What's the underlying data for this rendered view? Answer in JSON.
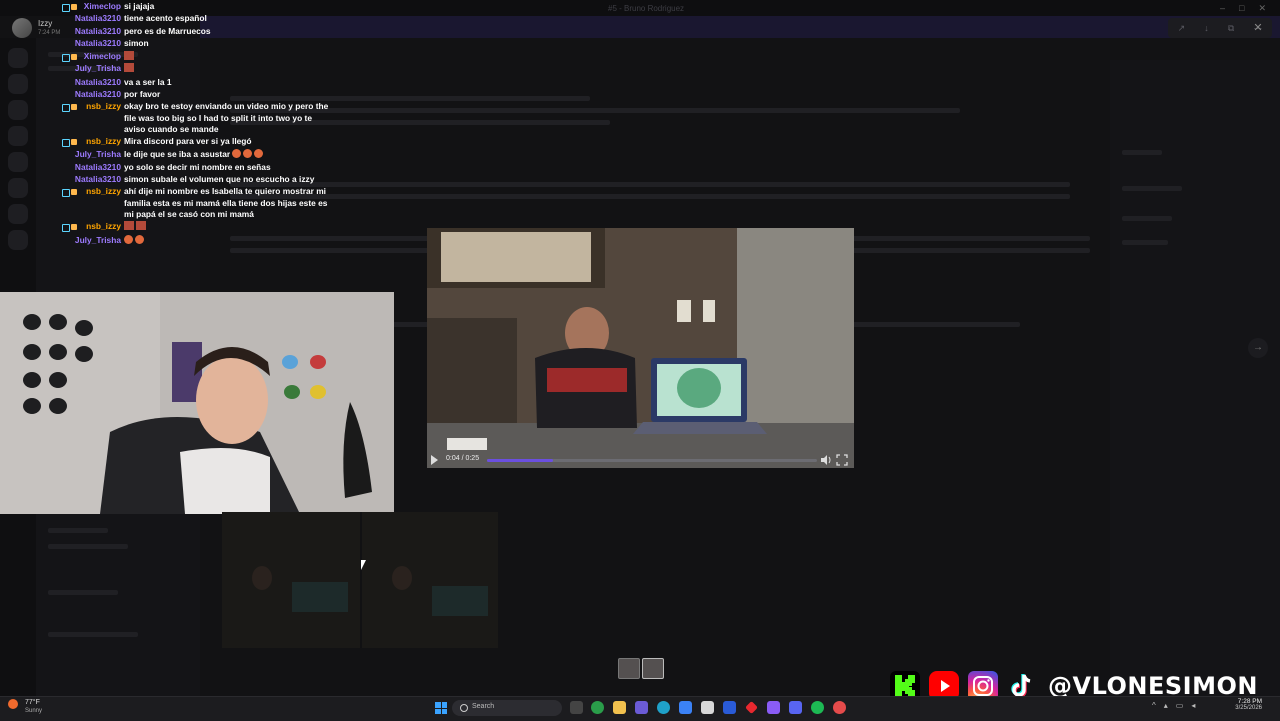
{
  "window": {
    "title": "#5 - Bruno Rodriguez"
  },
  "streamer": {
    "name": "Izzy",
    "time": "7:24 PM"
  },
  "chat": [
    {
      "user": "Ximeclop",
      "color": "#9d7bff",
      "badges": true,
      "text": "si jajaja"
    },
    {
      "user": "Natalia3210",
      "color": "#9d7bff",
      "badges": false,
      "text": "tiene acento español"
    },
    {
      "user": "Natalia3210",
      "color": "#9d7bff",
      "badges": false,
      "text": "pero es de Marruecos"
    },
    {
      "user": "Natalia3210",
      "color": "#9d7bff",
      "badges": false,
      "text": "simon"
    },
    {
      "user": "Ximeclop",
      "color": "#9d7bff",
      "badges": true,
      "text": ""
    },
    {
      "user": "July_Trisha",
      "color": "#9d7bff",
      "badges": false,
      "text": ""
    },
    {
      "user": "Natalia3210",
      "color": "#9d7bff",
      "badges": false,
      "text": "va a ser la 1"
    },
    {
      "user": "Natalia3210",
      "color": "#9d7bff",
      "badges": false,
      "text": "por favor"
    },
    {
      "user": "nsb_izzy",
      "color": "#ffa500",
      "badges": true,
      "text": "okay bro te estoy enviando un video mio y pero the file was too big so I had to split it into two yo te aviso cuando se mande"
    },
    {
      "user": "nsb_izzy",
      "color": "#ffa500",
      "badges": true,
      "text": "Mira discord para ver si ya llegó"
    },
    {
      "user": "July_Trisha",
      "color": "#9d7bff",
      "badges": false,
      "text": "le dije que se iba a asustar"
    },
    {
      "user": "Natalia3210",
      "color": "#9d7bff",
      "badges": false,
      "text": "yo solo se decir mi nombre en señas"
    },
    {
      "user": "Natalia3210",
      "color": "#9d7bff",
      "badges": false,
      "text": "simon subale el volumen que no escucho a izzy"
    },
    {
      "user": "nsb_izzy",
      "color": "#ffa500",
      "badges": true,
      "text": "ahí dije mi nombre es Isabella te quiero mostrar mi familia esta es mi mamá ella tiene dos hijas este es mi papá el se casó con mi mamá"
    },
    {
      "user": "nsb_izzy",
      "color": "#ffa500",
      "badges": true,
      "text": ""
    },
    {
      "user": "July_Trisha",
      "color": "#9d7bff",
      "badges": false,
      "text": ""
    }
  ],
  "player": {
    "time": "0:04 / 0:25",
    "progress": 0.2
  },
  "socials": {
    "handle": "@VLONESIMON",
    "icons": [
      "kick-icon",
      "youtube-icon",
      "instagram-icon",
      "tiktok-icon"
    ]
  },
  "taskbar": {
    "weather_temp": "77°F",
    "weather_cond": "Sunny",
    "search_placeholder": "Search",
    "clock_time": "7:28 PM",
    "clock_date": "3/25/2026"
  }
}
